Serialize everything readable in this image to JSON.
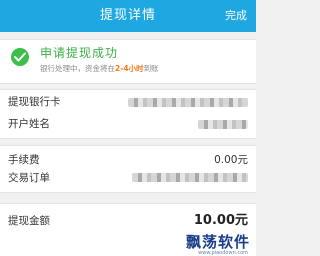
{
  "navbar": {
    "title": "提现详情",
    "done_label": "完成"
  },
  "success": {
    "title": "申请提现成功",
    "sub_prefix": "银行处理中，资金将在",
    "sub_highlight": "2-4小时",
    "sub_suffix": "到账",
    "icon": "check-circle-icon"
  },
  "bank_info": {
    "bank_card_label": "提现银行卡",
    "account_name_label": "开户姓名"
  },
  "fee_info": {
    "fee_label": "手续费",
    "fee_value": "0.00元",
    "order_label": "交易订单"
  },
  "amount_info": {
    "amount_label": "提现金额",
    "amount_value": "10.00元"
  },
  "watermark": {
    "text": "飘荡软件",
    "url": "www.piaodown.com"
  },
  "colors": {
    "primary": "#1ea7e1",
    "success": "#3bb047",
    "highlight": "#f07b17"
  }
}
